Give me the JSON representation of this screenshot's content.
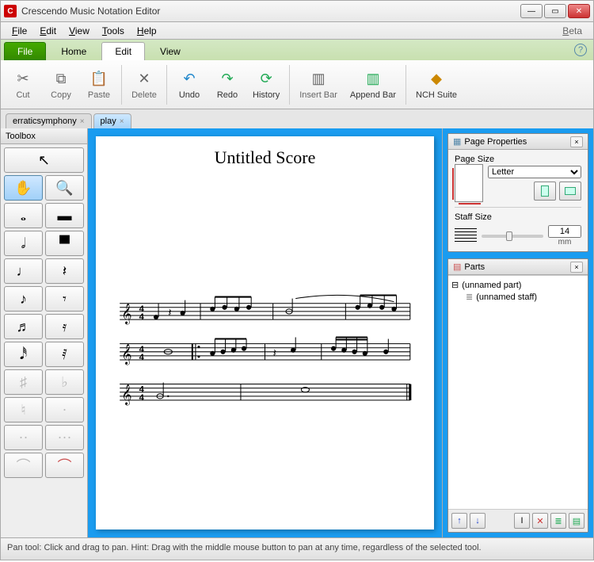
{
  "titlebar": {
    "app_title": "Crescendo Music Notation Editor"
  },
  "menubar": {
    "file": "File",
    "edit": "Edit",
    "view": "View",
    "tools": "Tools",
    "help": "Help",
    "beta": "Beta"
  },
  "ribbon_tabs": {
    "file": "File",
    "home": "Home",
    "edit": "Edit",
    "view": "View"
  },
  "toolbar": {
    "cut": "Cut",
    "copy": "Copy",
    "paste": "Paste",
    "delete": "Delete",
    "undo": "Undo",
    "redo": "Redo",
    "history": "History",
    "insert_bar": "Insert Bar",
    "append_bar": "Append Bar",
    "nch_suite": "NCH Suite"
  },
  "doc_tabs": [
    {
      "label": "erraticsymphony",
      "active": false
    },
    {
      "label": "play",
      "active": true
    }
  ],
  "toolbox": {
    "title": "Toolbox"
  },
  "score": {
    "title": "Untitled Score",
    "time_signature": "4/4"
  },
  "page_properties": {
    "title": "Page Properties",
    "page_size_label": "Page Size",
    "page_size_value": "Letter",
    "staff_size_label": "Staff Size",
    "staff_size_value": "14",
    "staff_size_unit": "mm"
  },
  "parts": {
    "title": "Parts",
    "items": [
      {
        "label": "(unnamed part)"
      },
      {
        "label": "(unnamed staff)"
      }
    ]
  },
  "statusbar": {
    "text": "Pan tool: Click and drag to pan. Hint: Drag with the middle mouse button to pan at any time, regardless of the selected tool."
  }
}
